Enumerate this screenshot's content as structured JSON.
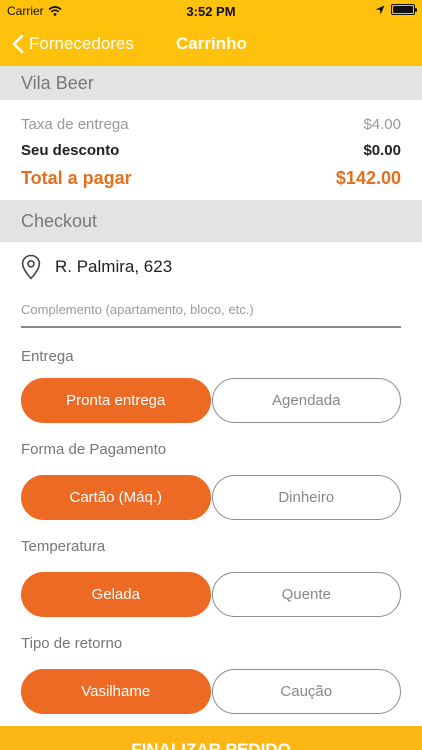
{
  "status_bar": {
    "carrier": "Carrier",
    "time": "3:52 PM"
  },
  "nav": {
    "back_label": "Fornecedores",
    "title": "Carrinho"
  },
  "store": {
    "name": "Vila Beer"
  },
  "summary": {
    "fee_label": "Taxa de entrega",
    "fee_value": "$4.00",
    "discount_label": "Seu desconto",
    "discount_value": "$0.00",
    "total_label": "Total a pagar",
    "total_value": "$142.00"
  },
  "checkout": {
    "title": "Checkout",
    "address": "R. Palmira, 623",
    "complement_placeholder": "Complemento (apartamento, bloco, etc.)"
  },
  "delivery": {
    "label": "Entrega",
    "options": [
      "Pronta entrega",
      "Agendada"
    ],
    "selected": "Pronta entrega"
  },
  "payment": {
    "label": "Forma de Pagamento",
    "options": [
      "Cartão (Máq.)",
      "Dinheiro"
    ],
    "selected": "Cartão (Máq.)"
  },
  "temperature": {
    "label": "Temperatura",
    "options": [
      "Gelada",
      "Quente"
    ],
    "selected": "Gelada"
  },
  "return_type": {
    "label": "Tipo de retorno",
    "options": [
      "Vasilhame",
      "Caução"
    ],
    "selected": "Vasilhame"
  },
  "footer": {
    "button_label": "FINALIZAR PEDIDO"
  },
  "colors": {
    "header": "#fec10c",
    "accent": "#ec6a24",
    "total": "#e2701f",
    "footer": "#fdb715"
  }
}
